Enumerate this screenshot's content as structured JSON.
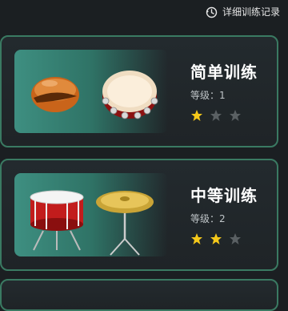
{
  "header": {
    "detail_record_label": "详细训练记录"
  },
  "cards": [
    {
      "title": "简单训练",
      "level_text": "等级：1",
      "rating": 1,
      "max_rating": 3,
      "instruments": [
        "cabasa-icon",
        "tambourine-icon"
      ]
    },
    {
      "title": "中等训练",
      "level_text": "等级：2",
      "rating": 2,
      "max_rating": 3,
      "instruments": [
        "bass-drum-icon",
        "cymbal-icon"
      ]
    }
  ],
  "colors": {
    "accent_border": "#3a7a62",
    "star_on": "#f4c81a",
    "star_off": "#5a6063"
  }
}
